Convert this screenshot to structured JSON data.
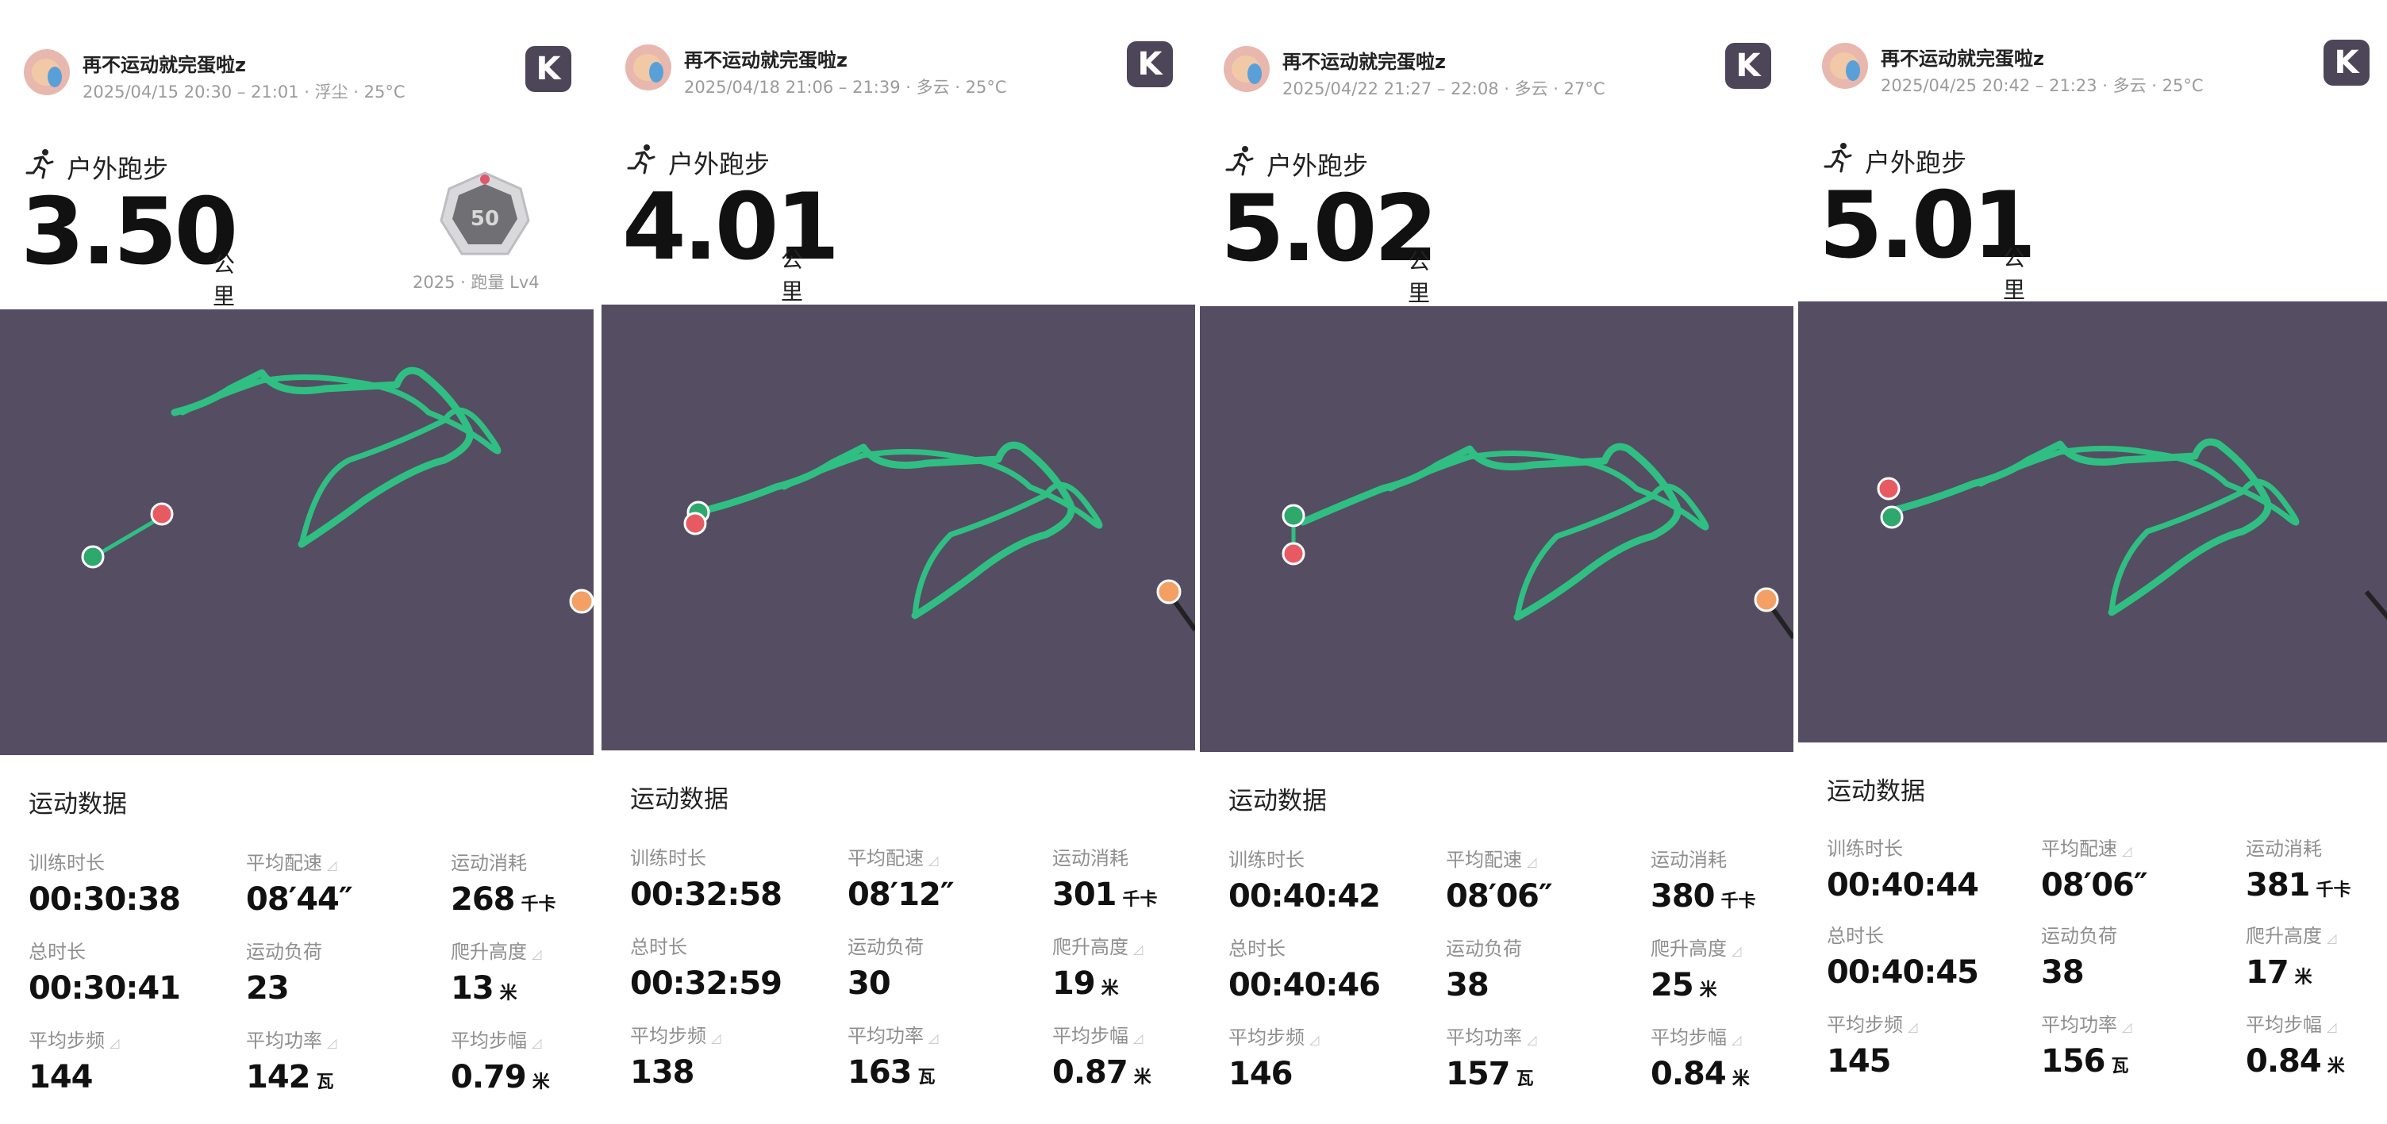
{
  "shared": {
    "sport_label": "户外跑步",
    "distance_unit": "公里",
    "section_title": "运动数据",
    "badge_caption": "2025 · 跑量 Lv4",
    "badge_number": "50",
    "logo_letter": "K",
    "map_colors": {
      "background": "#554d61",
      "route": "#2fbf83",
      "start": "#2ea86d",
      "end": "#e85a62"
    },
    "stat_labels": {
      "training_time": "训练时长",
      "avg_pace": "平均配速",
      "calories": "运动消耗",
      "total_time": "总时长",
      "load": "运动负荷",
      "elevation": "爬升高度",
      "cadence": "平均步频",
      "power": "平均功率",
      "stride": "平均步幅"
    },
    "units": {
      "calories": "千卡",
      "elevation": "米",
      "power": "瓦",
      "stride": "米"
    }
  },
  "panels": [
    {
      "user": "再不运动就完蛋啦z",
      "meta": "2025/04/15 20:30 – 21:01 · 浮尘 · 25°C",
      "distance": "3.50",
      "stats": {
        "training_time": "00:30:38",
        "avg_pace": "08′44″",
        "calories": "268",
        "total_time": "00:30:41",
        "load": "23",
        "elevation": "13",
        "cadence": "144",
        "power": "142",
        "stride": "0.79"
      }
    },
    {
      "user": "再不运动就完蛋啦z",
      "meta": "2025/04/18 21:06 – 21:39 · 多云 · 25°C",
      "distance": "4.01",
      "stats": {
        "training_time": "00:32:58",
        "avg_pace": "08′12″",
        "calories": "301",
        "total_time": "00:32:59",
        "load": "30",
        "elevation": "19",
        "cadence": "138",
        "power": "163",
        "stride": "0.87"
      }
    },
    {
      "user": "再不运动就完蛋啦z",
      "meta": "2025/04/22 21:27 – 22:08 · 多云 · 27°C",
      "distance": "5.02",
      "stats": {
        "training_time": "00:40:42",
        "avg_pace": "08′06″",
        "calories": "380",
        "total_time": "00:40:46",
        "load": "38",
        "elevation": "25",
        "cadence": "146",
        "power": "157",
        "stride": "0.84"
      }
    },
    {
      "user": "再不运动就完蛋啦z",
      "meta": "2025/04/25 20:42 – 21:23 · 多云 · 25°C",
      "distance": "5.01",
      "stats": {
        "training_time": "00:40:44",
        "avg_pace": "08′06″",
        "calories": "381",
        "total_time": "00:40:45",
        "load": "38",
        "elevation": "17",
        "cadence": "145",
        "power": "156",
        "stride": "0.84"
      }
    }
  ]
}
